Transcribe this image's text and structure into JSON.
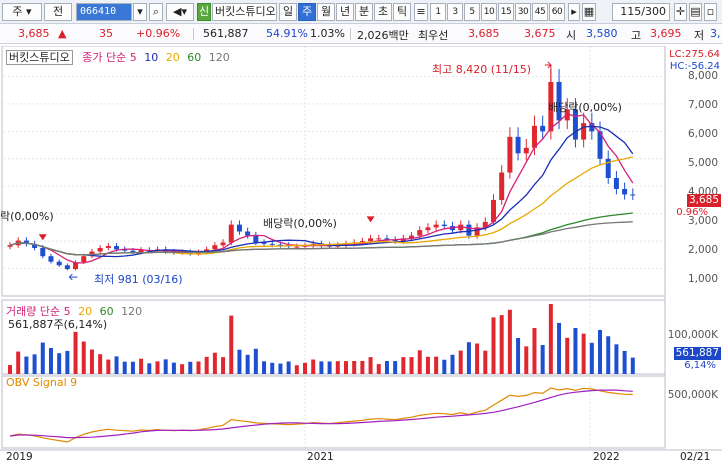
{
  "toolbar": {
    "market": "주",
    "scope": "전",
    "code": "066410",
    "badge": "신",
    "name": "버킷스튜디오",
    "periods": [
      "일",
      "주",
      "월",
      "년",
      "분",
      "초",
      "틱"
    ],
    "selected_period": "주",
    "intervals": [
      "1",
      "3",
      "5",
      "10",
      "15",
      "30",
      "45",
      "60"
    ],
    "count": "115/300"
  },
  "quote": {
    "price": "3,685",
    "change": "35",
    "change_pct": "+0.96%",
    "volume": "561,887",
    "volume_ratio": "54.91%",
    "turnover_pct": "1.03%",
    "amount": "2,026백만",
    "best_ask_label": "최우선",
    "best_ask": "3,685",
    "best_bid": "3,675",
    "open_label": "시",
    "open": "3,580",
    "high_label": "고",
    "high": "3,695",
    "low_label": "저",
    "low": "3,"
  },
  "price_pane": {
    "legend_name": "버킷스튜디오",
    "legend_ma": "종가 단순",
    "ma_periods": [
      "5",
      "10",
      "20",
      "60",
      "120"
    ],
    "ma_colors": [
      "#d6207a",
      "#1a2fb8",
      "#e8a800",
      "#2a8a2a",
      "#777777"
    ],
    "lc": "LC:275.64",
    "hc": "HC:-56.24",
    "current_price": "3,685",
    "current_pct": "0.96%",
    "annotations": {
      "high": "최고 8,420 (11/15)",
      "low": "최저 981 (03/16)",
      "div1": "배당락(0,00%)",
      "div2": "배당락(0,00%)",
      "left": "락(0,00%)"
    },
    "y_ticks": [
      "8,000",
      "7,000",
      "6,000",
      "5,000",
      "4,000",
      "3,000",
      "2,000",
      "1,000"
    ]
  },
  "volume_pane": {
    "legend": "거래량  단순",
    "ma_periods": [
      "5",
      "20",
      "60",
      "120"
    ],
    "value": "561,887주(6,14%)",
    "y_tick": "100,000K",
    "tag": "561,887",
    "tag_pct": "6,14%"
  },
  "obv_pane": {
    "legend": "OBV  Signal 9",
    "y_tick": "500,000K"
  },
  "x_axis": {
    "labels": [
      "2019",
      "2021",
      "2022",
      "02/21"
    ]
  },
  "chart_data": {
    "type": "candlestick",
    "weekly_close_approx": [
      1850,
      2020,
      1900,
      1750,
      1450,
      1250,
      1120,
      981,
      1230,
      1450,
      1620,
      1750,
      1820,
      1700,
      1650,
      1600,
      1680,
      1650,
      1700,
      1620,
      1580,
      1600,
      1550,
      1600,
      1700,
      1850,
      1950,
      2600,
      2350,
      2200,
      1950,
      1900,
      1870,
      1850,
      1800,
      1800,
      1830,
      1900,
      1850,
      1800,
      1850,
      1900,
      1950,
      2000,
      2100,
      2100,
      2050,
      2000,
      2100,
      2200,
      2400,
      2500,
      2600,
      2550,
      2400,
      2600,
      2200,
      2500,
      2700,
      3500,
      4500,
      5800,
      5200,
      5400,
      6200,
      6000,
      7800,
      6400,
      6800,
      5700,
      6300,
      6000,
      5000,
      4300,
      3900,
      3700,
      3685
    ],
    "high_point": {
      "label": "최고 8,420 (11/15)",
      "value": 8420
    },
    "low_point": {
      "label": "최저 981 (03/16)",
      "value": 981
    },
    "ylim": [
      0,
      8600
    ]
  }
}
